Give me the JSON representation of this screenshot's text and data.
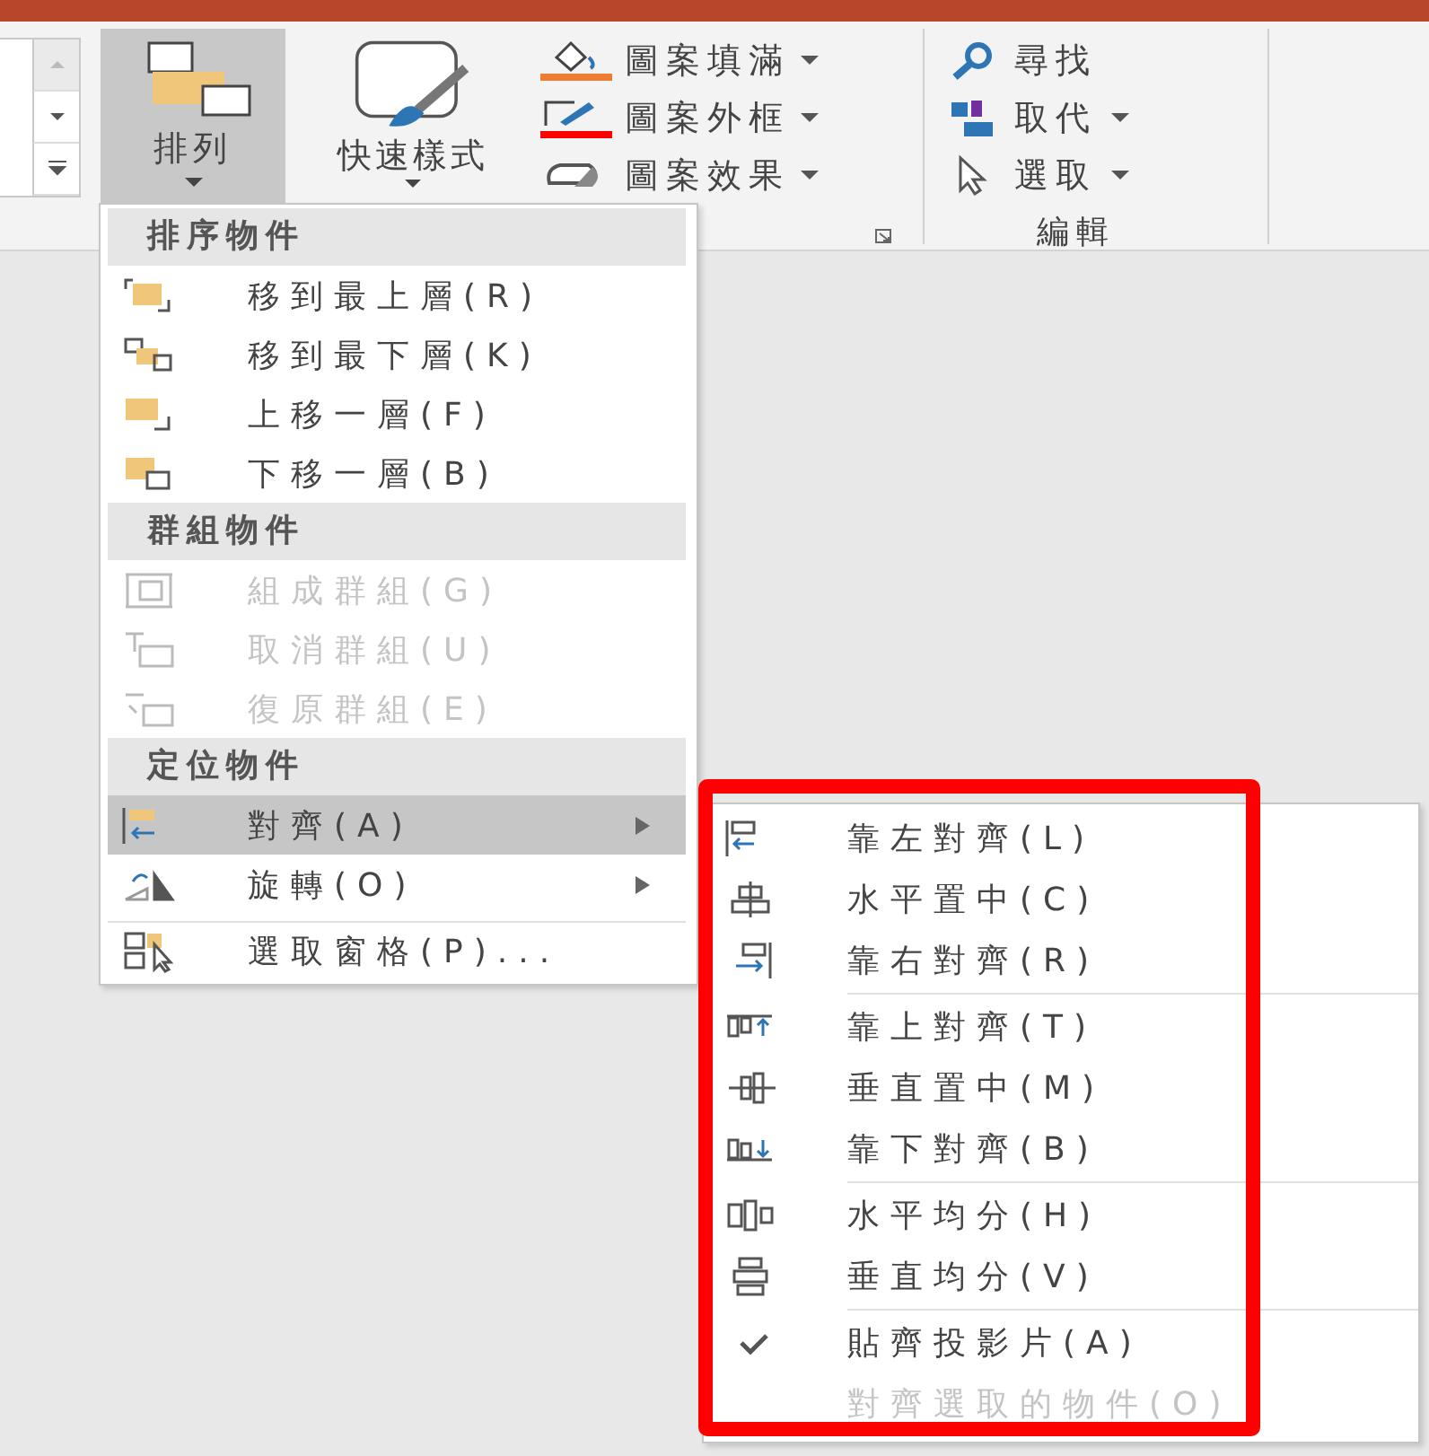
{
  "ribbon": {
    "gallery_scroll": [
      {
        "kind": "up",
        "disabled": true
      },
      {
        "kind": "down",
        "disabled": false
      },
      {
        "kind": "more",
        "disabled": false
      }
    ],
    "arrange_button": {
      "label": "排列",
      "selected": true
    },
    "quick_styles_button": {
      "label": "快速樣式"
    },
    "shape_commands": [
      {
        "label": "圖案填滿",
        "kind": "fill"
      },
      {
        "label": "圖案外框",
        "kind": "outline"
      },
      {
        "label": "圖案效果",
        "kind": "effects"
      }
    ],
    "editing_group": {
      "label": "編輯",
      "commands": [
        {
          "label": "尋找",
          "kind": "find",
          "dropdown": false
        },
        {
          "label": "取代",
          "kind": "replace",
          "dropdown": true
        },
        {
          "label": "選取",
          "kind": "select",
          "dropdown": true
        }
      ]
    }
  },
  "arrange_menu": {
    "sections": [
      {
        "header": "排序物件",
        "items": [
          {
            "label": "移到最上層(R)",
            "kind": "front",
            "disabled": false,
            "selected": false,
            "submenu": false
          },
          {
            "label": "移到最下層(K)",
            "kind": "back",
            "disabled": false,
            "selected": false,
            "submenu": false
          },
          {
            "label": "上移一層(F)",
            "kind": "forward",
            "disabled": false,
            "selected": false,
            "submenu": false
          },
          {
            "label": "下移一層(B)",
            "kind": "backward",
            "disabled": false,
            "selected": false,
            "submenu": false
          }
        ]
      },
      {
        "header": "群組物件",
        "items": [
          {
            "label": "組成群組(G)",
            "kind": "group",
            "disabled": true,
            "selected": false,
            "submenu": false
          },
          {
            "label": "取消群組(U)",
            "kind": "ungroup",
            "disabled": true,
            "selected": false,
            "submenu": false
          },
          {
            "label": "復原群組(E)",
            "kind": "regroup",
            "disabled": true,
            "selected": false,
            "submenu": false
          }
        ]
      },
      {
        "header": "定位物件",
        "items": [
          {
            "label": "對齊(A)",
            "kind": "align",
            "disabled": false,
            "selected": true,
            "submenu": true
          },
          {
            "label": "旋轉(O)",
            "kind": "rotate",
            "disabled": false,
            "selected": false,
            "submenu": true
          },
          {
            "label": "選取窗格(P)...",
            "kind": "pane",
            "disabled": false,
            "selected": false,
            "submenu": false
          }
        ]
      }
    ]
  },
  "align_submenu": {
    "groups": [
      [
        {
          "label": "靠左對齊(L)",
          "kind": "left",
          "disabled": false
        },
        {
          "label": "水平置中(C)",
          "kind": "center",
          "disabled": false
        },
        {
          "label": "靠右對齊(R)",
          "kind": "right",
          "disabled": false
        }
      ],
      [
        {
          "label": "靠上對齊(T)",
          "kind": "top",
          "disabled": false
        },
        {
          "label": "垂直置中(M)",
          "kind": "middle",
          "disabled": false
        },
        {
          "label": "靠下對齊(B)",
          "kind": "bottom",
          "disabled": false
        }
      ],
      [
        {
          "label": "水平均分(H)",
          "kind": "dist-h",
          "disabled": false
        },
        {
          "label": "垂直均分(V)",
          "kind": "dist-v",
          "disabled": false
        }
      ],
      [
        {
          "label": "貼齊投影片(A)",
          "kind": "check",
          "checked": true,
          "disabled": false
        },
        {
          "label": "對齊選取的物件(O)",
          "kind": "check",
          "checked": false,
          "disabled": true
        }
      ]
    ]
  }
}
